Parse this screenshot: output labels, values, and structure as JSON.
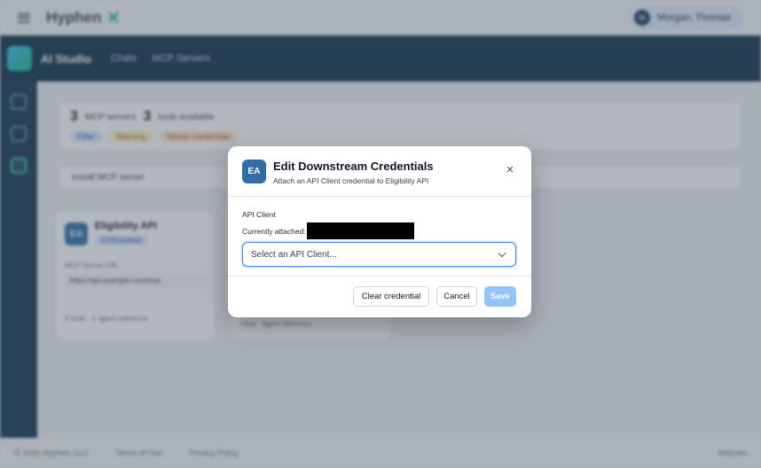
{
  "app": {
    "brand_name": "Hyphen",
    "user_initial": "M",
    "user_name": "Morgan, Thomas"
  },
  "nav": {
    "studio_title": "AI Studio",
    "links": [
      "Chats",
      "MCP Servers"
    ]
  },
  "background": {
    "stats": {
      "servers_count": "3",
      "servers_label": "MCP servers",
      "tools_count": "3",
      "tools_label": "tools available"
    },
    "chips": [
      "Filter",
      "Warning",
      "Needs credentials"
    ],
    "install_label": "Install MCP server",
    "cards": [
      {
        "initials": "EA",
        "name": "Eligibility API",
        "badge": "STREAMING",
        "label": "MCP Server URL",
        "url": "https://api.example.com/mcp",
        "footer": "3 tools · 1 agent reference"
      },
      {
        "initials": "",
        "name": "",
        "badge": "",
        "label": "",
        "url": "",
        "footer": "Chat · Agent reference"
      }
    ],
    "footer_left": "© 2025 Hyphen, LLC",
    "footer_links": [
      "Terms of Use",
      "Privacy Policy"
    ],
    "footer_right": "Website"
  },
  "modal": {
    "badge": "EA",
    "title": "Edit Downstream Credentials",
    "subtitle": "Attach an API Client credential to Eligibility API",
    "close_glyph": "×",
    "field_label": "API Client",
    "currently_attached_label": "Currently attached:",
    "select_placeholder": "Select an API Client...",
    "buttons": {
      "clear": "Clear credential",
      "cancel": "Cancel",
      "save": "Save"
    }
  }
}
